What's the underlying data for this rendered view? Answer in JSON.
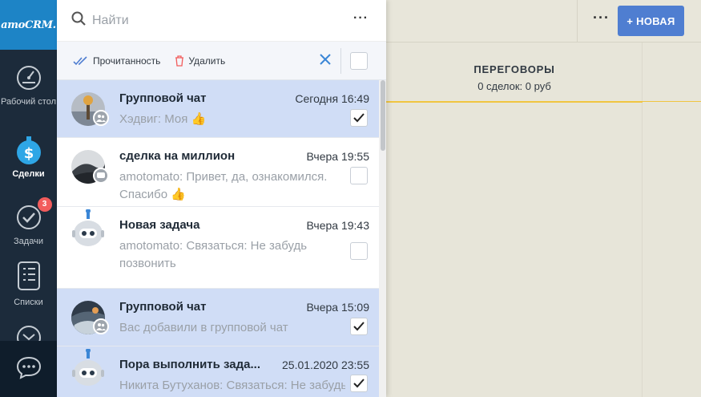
{
  "sidebar": {
    "logo": "amoCRM.",
    "items": [
      {
        "label": "Рабочий стол",
        "icon": "dashboard-icon"
      },
      {
        "label": "Сделки",
        "icon": "deals-icon",
        "active": true
      },
      {
        "label": "Задачи",
        "icon": "tasks-icon",
        "badge": "3"
      },
      {
        "label": "Списки",
        "icon": "lists-icon"
      }
    ],
    "chat_icon": "chat-icon"
  },
  "background": {
    "new_button": "+ НОВАЯ",
    "more": "···",
    "column_title": "ПЕРЕГОВОРЫ",
    "column_sub": "0 сделок: 0 руб"
  },
  "panel": {
    "search_placeholder": "Найти",
    "more": "···",
    "actions": {
      "read_label": "Прочитанность",
      "delete_label": "Удалить"
    },
    "chats": [
      {
        "title": "Групповой чат",
        "time": "Сегодня 16:49",
        "preview": "Хэдвиг: Моя",
        "emoji": "👍",
        "checked": true,
        "selected": true
      },
      {
        "title": "сделка на миллион",
        "time": "Вчера 19:55",
        "preview": "amotomato: Привет, да, ознакомился. Спасибо",
        "emoji": "👍",
        "checked": false,
        "selected": false
      },
      {
        "title": "Новая задача",
        "time": "Вчера 19:43",
        "preview": "amotomato: Связаться: Не забудь позвонить",
        "emoji": "",
        "checked": false,
        "selected": false
      },
      {
        "title": "Групповой чат",
        "time": "Вчера 15:09",
        "preview": "Вас добавили в групповой чат",
        "emoji": "",
        "checked": true,
        "selected": true
      },
      {
        "title": "Пора выполнить зада...",
        "time": "25.01.2020 23:55",
        "preview": "Никита Бутуханов: Связаться: Не забудь",
        "emoji": "",
        "checked": true,
        "selected": true
      }
    ]
  },
  "colors": {
    "sidebar": "#1c2b3b",
    "logo_bg": "#1d84c6",
    "selected_row": "#d0ddf6",
    "accent": "#4f7ed1",
    "badge": "#f25c5c"
  }
}
